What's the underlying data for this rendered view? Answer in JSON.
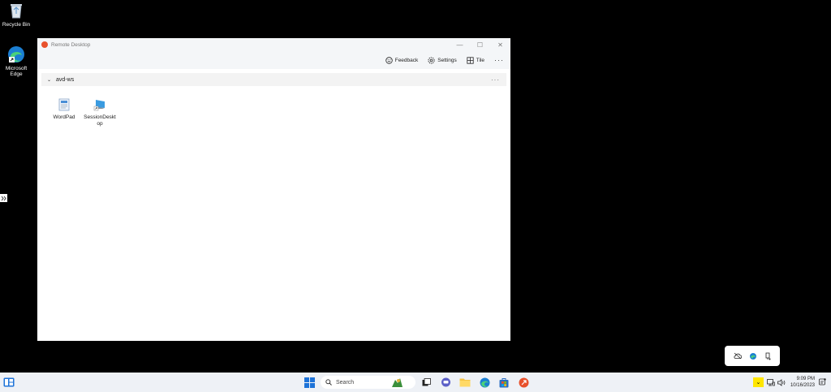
{
  "desktop": {
    "icons": [
      {
        "label": "Recycle Bin",
        "icon": "recycle-bin-icon"
      },
      {
        "label": "Microsoft Edge",
        "icon": "edge-icon"
      }
    ]
  },
  "window": {
    "title": "Remote Desktop",
    "toolbar": {
      "feedback": "Feedback",
      "settings": "Settings",
      "tile": "Tile",
      "more": "···"
    },
    "group": {
      "name": "avd-ws",
      "more": "···",
      "apps": [
        {
          "label": "WordPad",
          "icon": "wordpad-icon"
        },
        {
          "label": "SessionDesktop",
          "icon": "session-desktop-icon"
        }
      ]
    }
  },
  "taskbar": {
    "search_label": "Search",
    "time": "9:09 PM",
    "date": "10/16/2023"
  },
  "colors": {
    "accent": "#0a64c8",
    "tray_highlight": "#ffe600",
    "rd_logo": "#e8512c"
  }
}
